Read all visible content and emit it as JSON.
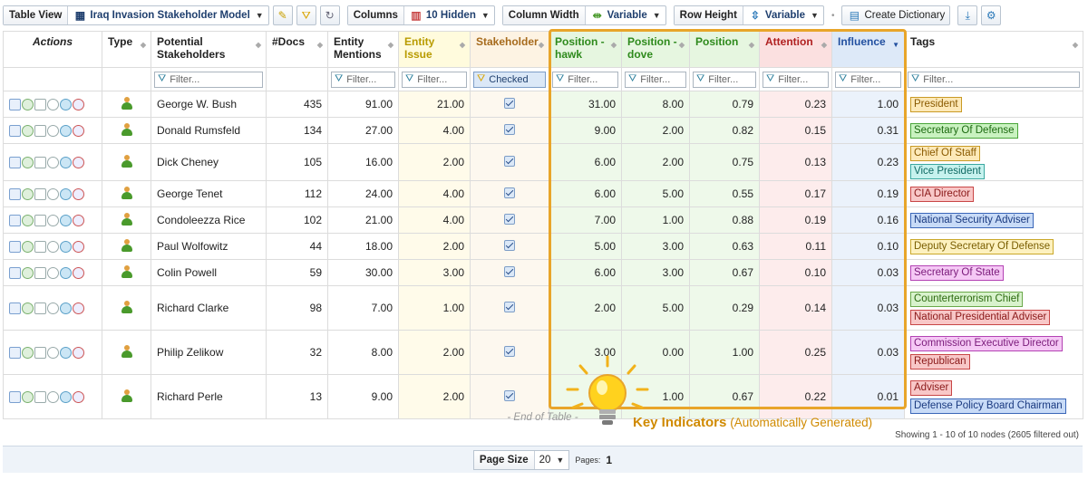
{
  "toolbar": {
    "table_view_label": "Table View",
    "table_view_value": "Iraq Invasion Stakeholder Model",
    "columns_label": "Columns",
    "columns_value": "10 Hidden",
    "column_width_label": "Column Width",
    "column_width_value": "Variable",
    "row_height_label": "Row Height",
    "row_height_value": "Variable",
    "create_dictionary_label": "Create Dictionary"
  },
  "columns": {
    "actions": "Actions",
    "type": "Type",
    "potential_stakeholders": "Potential Stakeholders",
    "docs": "#Docs",
    "entity_mentions": "Entity Mentions",
    "entity_issue": "Entity Issue",
    "stakeholder": "Stakeholder",
    "position_hawk": "Position - hawk",
    "position_dove": "Position - dove",
    "position": "Position",
    "attention": "Attention",
    "influence": "Influence",
    "tags": "Tags"
  },
  "filters": {
    "placeholder": "Filter...",
    "stakeholder_checked": "Checked"
  },
  "rows": [
    {
      "name": "George W. Bush",
      "docs": "435",
      "mentions": "91.00",
      "issue": "21.00",
      "hawk": "31.00",
      "dove": "8.00",
      "position": "0.79",
      "attention": "0.23",
      "influence": "1.00",
      "tags": [
        {
          "label": "President",
          "color": "orange"
        }
      ]
    },
    {
      "name": "Donald Rumsfeld",
      "docs": "134",
      "mentions": "27.00",
      "issue": "4.00",
      "hawk": "9.00",
      "dove": "2.00",
      "position": "0.82",
      "attention": "0.15",
      "influence": "0.31",
      "tags": [
        {
          "label": "Secretary Of Defense",
          "color": "green"
        }
      ]
    },
    {
      "name": "Dick Cheney",
      "docs": "105",
      "mentions": "16.00",
      "issue": "2.00",
      "hawk": "6.00",
      "dove": "2.00",
      "position": "0.75",
      "attention": "0.13",
      "influence": "0.23",
      "tags": [
        {
          "label": "Chief Of Staff",
          "color": "orange"
        },
        {
          "label": "Vice President",
          "color": "teal"
        }
      ]
    },
    {
      "name": "George Tenet",
      "docs": "112",
      "mentions": "24.00",
      "issue": "4.00",
      "hawk": "6.00",
      "dove": "5.00",
      "position": "0.55",
      "attention": "0.17",
      "influence": "0.19",
      "tags": [
        {
          "label": "CIA Director",
          "color": "red"
        }
      ]
    },
    {
      "name": "Condoleezza Rice",
      "docs": "102",
      "mentions": "21.00",
      "issue": "4.00",
      "hawk": "7.00",
      "dove": "1.00",
      "position": "0.88",
      "attention": "0.19",
      "influence": "0.16",
      "tags": [
        {
          "label": "National Security Adviser",
          "color": "blue"
        }
      ]
    },
    {
      "name": "Paul Wolfowitz",
      "docs": "44",
      "mentions": "18.00",
      "issue": "2.00",
      "hawk": "5.00",
      "dove": "3.00",
      "position": "0.63",
      "attention": "0.11",
      "influence": "0.10",
      "tags": [
        {
          "label": "Deputy Secretary Of Defense",
          "color": "yellow"
        }
      ]
    },
    {
      "name": "Colin Powell",
      "docs": "59",
      "mentions": "30.00",
      "issue": "3.00",
      "hawk": "6.00",
      "dove": "3.00",
      "position": "0.67",
      "attention": "0.10",
      "influence": "0.03",
      "tags": [
        {
          "label": "Secretary Of State",
          "color": "magenta"
        }
      ]
    },
    {
      "name": "Richard Clarke",
      "docs": "98",
      "mentions": "7.00",
      "issue": "1.00",
      "hawk": "2.00",
      "dove": "5.00",
      "position": "0.29",
      "attention": "0.14",
      "influence": "0.03",
      "tags": [
        {
          "label": "Counterterrorism Chief",
          "color": "lgreen"
        },
        {
          "label": "National Presidential Adviser",
          "color": "red"
        }
      ]
    },
    {
      "name": "Philip Zelikow",
      "docs": "32",
      "mentions": "8.00",
      "issue": "2.00",
      "hawk": "3.00",
      "dove": "0.00",
      "position": "1.00",
      "attention": "0.25",
      "influence": "0.03",
      "tags": [
        {
          "label": "Commission Executive Director",
          "color": "magenta"
        },
        {
          "label": "Republican",
          "color": "red"
        }
      ]
    },
    {
      "name": "Richard Perle",
      "docs": "13",
      "mentions": "9.00",
      "issue": "2.00",
      "hawk": "",
      "dove": "1.00",
      "position": "0.67",
      "attention": "0.22",
      "influence": "0.01",
      "tags": [
        {
          "label": "Adviser",
          "color": "red"
        },
        {
          "label": "Defense Policy Board Chairman",
          "color": "blue"
        }
      ]
    }
  ],
  "end_of_table": "- End of Table -",
  "status": "Showing 1 - 10 of 10 nodes (2605 filtered out)",
  "pager": {
    "page_size_label": "Page Size",
    "page_size_value": "20",
    "pages_label": "Pages:",
    "current_page": "1"
  },
  "callout": {
    "title": "Key Indicators",
    "subtitle": "(Automatically Generated)"
  },
  "colors": {
    "highlight": "#e8a52a",
    "accent": "#1f3f6e"
  }
}
